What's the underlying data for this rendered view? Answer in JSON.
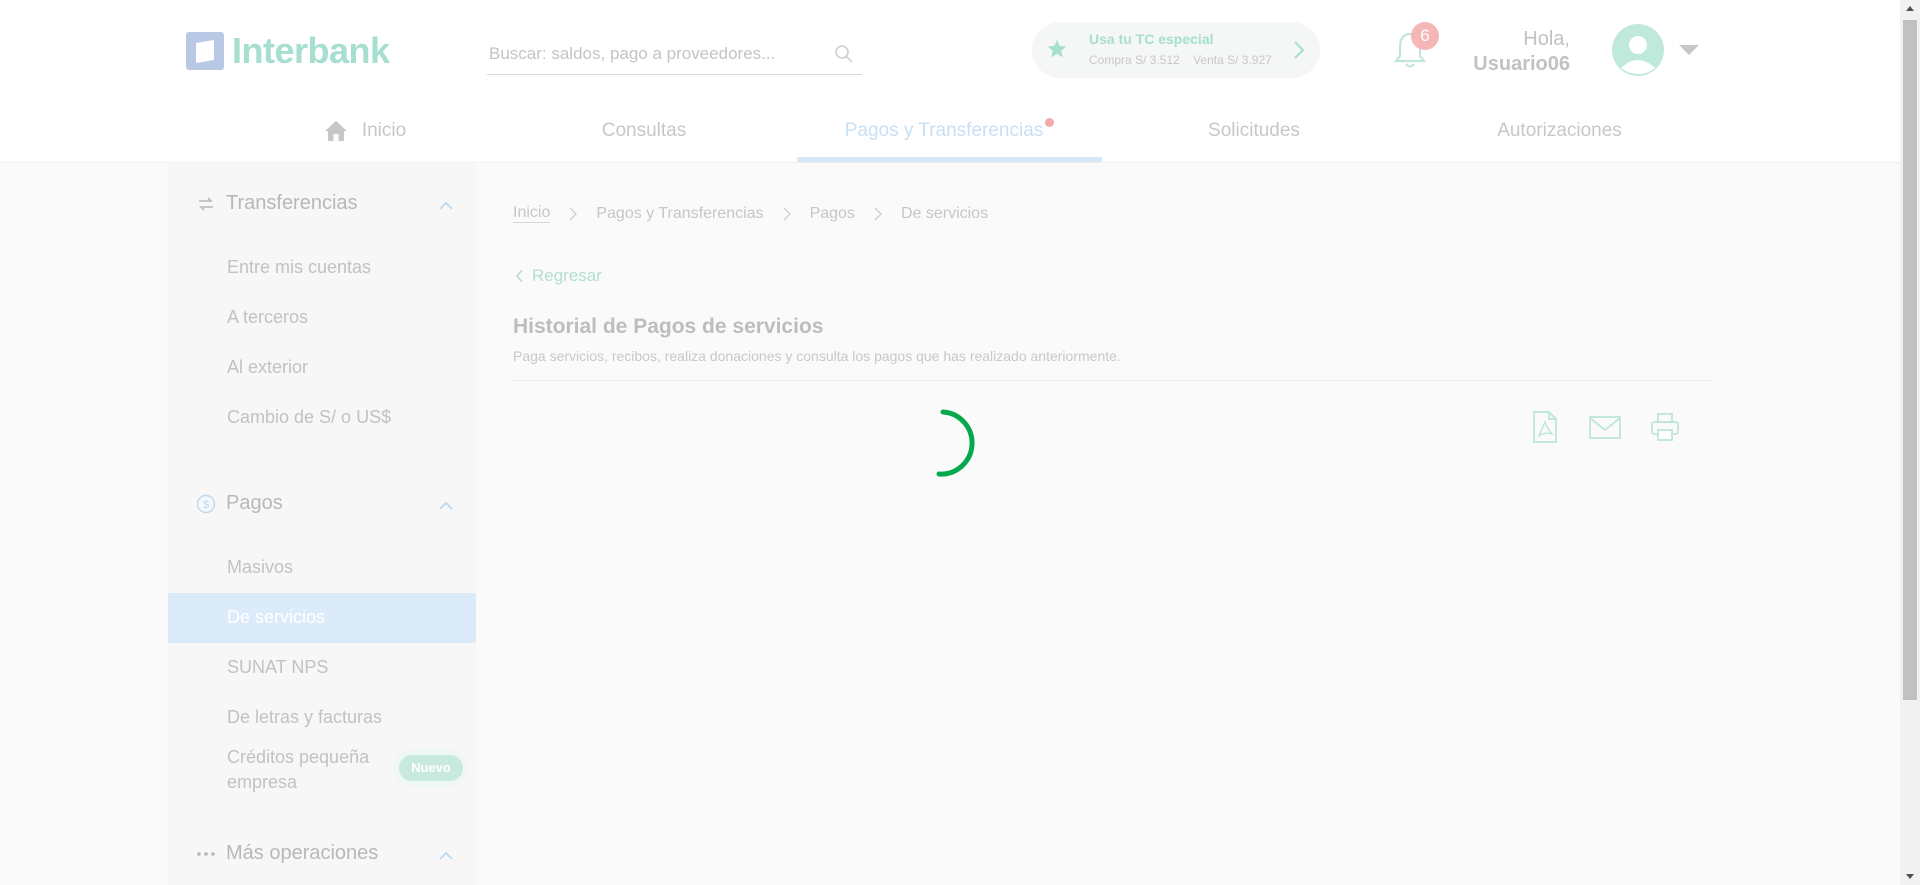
{
  "header": {
    "logo_text": "Interbank",
    "search_placeholder": "Buscar: saldos, pago a proveedores...",
    "promo": {
      "title": "Usa tu TC especial",
      "compra": "Compra S/ 3.512",
      "venta": "Venta S/ 3.927"
    },
    "notification_count": "6",
    "greeting": "Hola,",
    "username": "Usuario06"
  },
  "nav": [
    {
      "label": "Inicio",
      "icon": "home-icon"
    },
    {
      "label": "Consultas"
    },
    {
      "label": "Pagos y Transferencias",
      "active": true
    },
    {
      "label": "Solicitudes"
    },
    {
      "label": "Autorizaciones"
    }
  ],
  "sidebar": {
    "transferencias": {
      "title": "Transferencias",
      "items": [
        "Entre mis cuentas",
        "A terceros",
        "Al exterior",
        "Cambio de S/ o US$"
      ]
    },
    "pagos": {
      "title": "Pagos",
      "items": [
        "Masivos",
        "De servicios",
        "SUNAT NPS",
        "De letras y facturas",
        "Créditos pequeña empresa"
      ],
      "selected": "De servicios",
      "nuevo_badge": "Nuevo"
    },
    "mas": {
      "title": "Más operaciones"
    }
  },
  "breadcrumb": [
    "Inicio",
    "Pagos y Transferencias",
    "Pagos",
    "De servicios"
  ],
  "back_label": "Regresar",
  "page": {
    "title": "Historial de Pagos de servicios",
    "subtitle": "Paga servicios, recibos, realiza donaciones y consulta los pagos que has realizado anteriormente."
  },
  "colors": {
    "brand_green": "#05be50",
    "spinner": "#05a84c",
    "active_nav": "#c9dff4",
    "selected_bg": "#dcebf9"
  }
}
